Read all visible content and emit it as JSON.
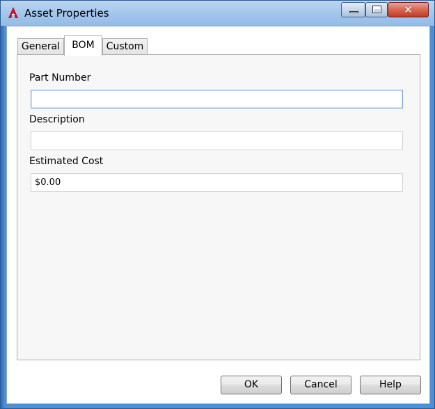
{
  "window": {
    "title": "Asset Properties",
    "close_glyph": "✕"
  },
  "tabs": [
    {
      "label": "General",
      "active": false
    },
    {
      "label": "BOM",
      "active": true
    },
    {
      "label": "Custom",
      "active": false
    }
  ],
  "bom": {
    "part_number": {
      "label": "Part Number",
      "value": ""
    },
    "description": {
      "label": "Description",
      "value": ""
    },
    "estimated_cost": {
      "label": "Estimated Cost",
      "value": "$0.00"
    }
  },
  "buttons": {
    "ok": "OK",
    "cancel": "Cancel",
    "help": "Help"
  },
  "colors": {
    "title_gradient": "#a6c8ec",
    "frame": "#4f8fd6",
    "close_button": "#c23b22",
    "focus_border": "#7aa7d8"
  },
  "icons": {
    "app": "autocad-logo-icon",
    "minimize": "minimize-icon",
    "maximize": "maximize-icon",
    "close": "close-icon"
  }
}
